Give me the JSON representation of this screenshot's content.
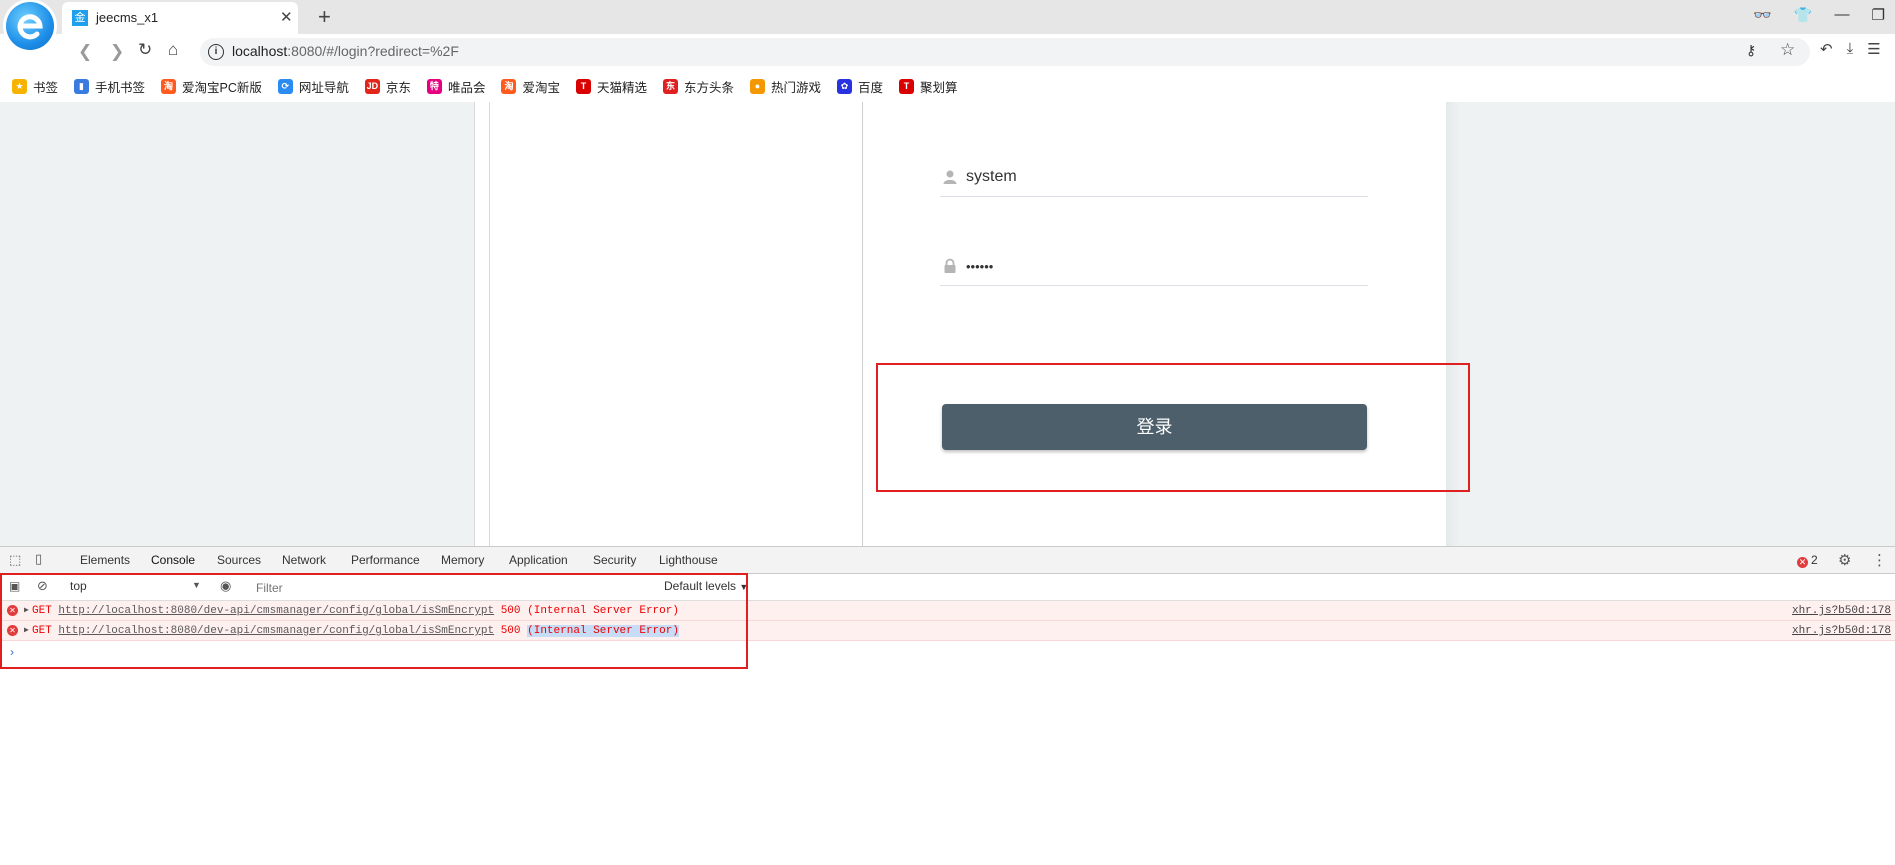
{
  "browser": {
    "tab_title": "jeecms_x1",
    "tab_favicon": "金",
    "url_host": "localhost",
    "url_rest": ":8080/#/login?redirect=%2F"
  },
  "bookmarks": [
    {
      "label": "书签",
      "icon": "star-icon",
      "color": "#f6b400",
      "glyph": "★"
    },
    {
      "label": "手机书签",
      "icon": "phone-bookmark-icon",
      "color": "#3a7be0",
      "glyph": "▮"
    },
    {
      "label": "爱淘宝PC新版",
      "icon": "aitaobao-icon",
      "color": "#ff5a1f",
      "glyph": "淘"
    },
    {
      "label": "网址导航",
      "icon": "nav-icon",
      "color": "#2a8bf2",
      "glyph": "⟳"
    },
    {
      "label": "京东",
      "icon": "jd-icon",
      "color": "#e1251b",
      "glyph": "JD"
    },
    {
      "label": "唯品会",
      "icon": "vip-icon",
      "color": "#e4007f",
      "glyph": "特"
    },
    {
      "label": "爱淘宝",
      "icon": "aitaobao2-icon",
      "color": "#ff5a1f",
      "glyph": "淘"
    },
    {
      "label": "天猫精选",
      "icon": "tmall-icon",
      "color": "#d80000",
      "glyph": "T"
    },
    {
      "label": "东方头条",
      "icon": "dongfang-icon",
      "color": "#e02020",
      "glyph": "东"
    },
    {
      "label": "热门游戏",
      "icon": "games-icon",
      "color": "#f39800",
      "glyph": "●"
    },
    {
      "label": "百度",
      "icon": "baidu-icon",
      "color": "#2932e1",
      "glyph": "✿"
    },
    {
      "label": "聚划算",
      "icon": "juhuasuan-icon",
      "color": "#d80000",
      "glyph": "T"
    }
  ],
  "login": {
    "username": "system",
    "password_mask": "••••••",
    "submit_label": "登录"
  },
  "devtools": {
    "tabs": [
      "Elements",
      "Console",
      "Sources",
      "Network",
      "Performance",
      "Memory",
      "Application",
      "Security",
      "Lighthouse"
    ],
    "error_count": "2",
    "context": "top",
    "filter_placeholder": "Filter",
    "levels": "Default levels",
    "messages": [
      {
        "method": "GET",
        "url": "http://localhost:8080/dev-api/cmsmanager/config/global/isSmEncrypt",
        "status": "500",
        "status_text": "(Internal Server Error)",
        "source": "xhr.js?b50d:178"
      },
      {
        "method": "GET",
        "url": "http://localhost:8080/dev-api/cmsmanager/config/global/isSmEncrypt",
        "status": "500",
        "status_text": "(Internal Server Error)",
        "source": "xhr.js?b50d:178"
      }
    ],
    "prompt": "›"
  }
}
